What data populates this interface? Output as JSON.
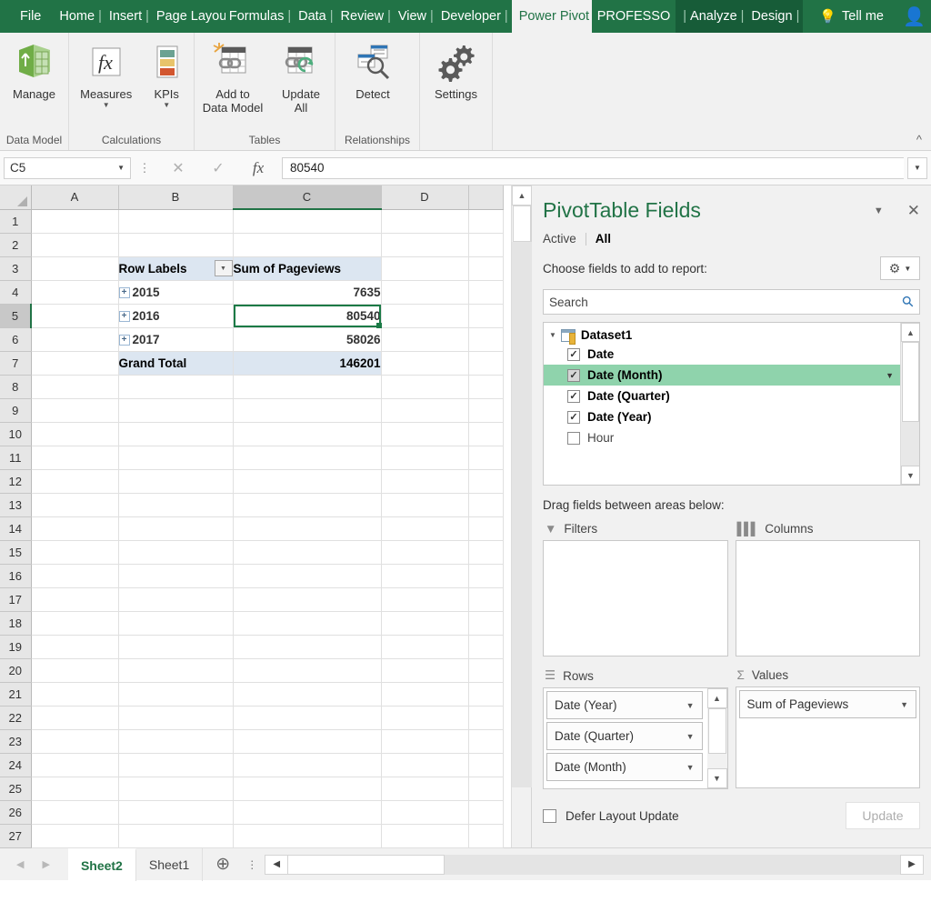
{
  "ribbon": {
    "tabs": [
      {
        "label": "File",
        "active": false
      },
      {
        "label": "Home",
        "active": false
      },
      {
        "label": "Insert",
        "active": false
      },
      {
        "label": "Page Layout",
        "active": false
      },
      {
        "label": "Formulas",
        "active": false
      },
      {
        "label": "Data",
        "active": false
      },
      {
        "label": "Review",
        "active": false
      },
      {
        "label": "View",
        "active": false
      },
      {
        "label": "Developer",
        "active": false
      },
      {
        "label": "Power Pivot",
        "active": true
      }
    ],
    "contextual": {
      "group_label": "PROFESSO",
      "tabs": [
        "Analyze",
        "Design"
      ]
    },
    "tell_me": "Tell me",
    "share_icon": "person-add-icon",
    "collapse_icon": "chevron-up-icon",
    "groups": [
      {
        "title": "Data Model",
        "buttons": [
          {
            "label": "Manage",
            "icon": "power-pivot-manage-icon",
            "caret": false
          }
        ]
      },
      {
        "title": "Calculations",
        "buttons": [
          {
            "label": "Measures",
            "icon": "fx-measures-icon",
            "caret": true
          },
          {
            "label": "KPIs",
            "icon": "kpi-icon",
            "caret": true
          }
        ]
      },
      {
        "title": "Tables",
        "buttons": [
          {
            "label": "Add to\nData Model",
            "icon": "add-to-data-model-icon",
            "caret": false
          },
          {
            "label": "Update\nAll",
            "icon": "update-all-icon",
            "caret": false
          }
        ]
      },
      {
        "title": "Relationships",
        "buttons": [
          {
            "label": "Detect",
            "icon": "detect-relationships-icon",
            "caret": false
          }
        ]
      },
      {
        "title": "",
        "buttons": [
          {
            "label": "Settings",
            "icon": "settings-gears-icon",
            "caret": false
          }
        ]
      }
    ]
  },
  "formula_bar": {
    "name_box": "C5",
    "cancel_icon": "x-icon",
    "confirm_icon": "check-icon",
    "fx_icon": "fx-icon",
    "value": "80540"
  },
  "grid": {
    "columns": [
      "A",
      "B",
      "C",
      "D"
    ],
    "selected_column": "C",
    "selected_row": 5,
    "selected_cell": "C5",
    "rows": [
      1,
      2,
      3,
      4,
      5,
      6,
      7,
      8,
      9,
      10,
      11,
      12,
      13,
      14,
      15,
      16,
      17,
      18,
      19,
      20,
      21,
      22,
      23,
      24,
      25,
      26,
      27
    ],
    "pivot": {
      "header_row": 3,
      "row_labels_header": "Row Labels",
      "value_header": "Sum of Pageviews",
      "filter_icon": "filter-dropdown-icon",
      "expand_icon": "expand-plus-icon",
      "data": [
        {
          "row": 4,
          "label": "2015",
          "value": "7635"
        },
        {
          "row": 5,
          "label": "2016",
          "value": "80540"
        },
        {
          "row": 6,
          "label": "2017",
          "value": "58026"
        }
      ],
      "total_row": {
        "row": 7,
        "label": "Grand Total",
        "value": "146201"
      }
    }
  },
  "pane": {
    "title": "PivotTable Fields",
    "menu_icon": "chevron-down-icon",
    "close_icon": "close-icon",
    "tabs": [
      {
        "label": "Active",
        "active": false
      },
      {
        "label": "All",
        "active": true
      }
    ],
    "choose_label": "Choose fields to add to report:",
    "gear_icon": "gear-icon",
    "gear_caret_icon": "chevron-down-icon",
    "search_placeholder": "Search",
    "search_icon": "search-icon",
    "table_name": "Dataset1",
    "table_icon": "table-icon",
    "fields": [
      {
        "label": "Date",
        "checked": true,
        "highlighted": false,
        "greyed": false
      },
      {
        "label": "Date (Month)",
        "checked": true,
        "highlighted": true,
        "greyed": true
      },
      {
        "label": "Date (Quarter)",
        "checked": true,
        "highlighted": false,
        "greyed": false
      },
      {
        "label": "Date (Year)",
        "checked": true,
        "highlighted": false,
        "greyed": false
      },
      {
        "label": "Hour",
        "checked": false,
        "highlighted": false,
        "greyed": false
      }
    ],
    "drag_label": "Drag fields between areas below:",
    "areas": {
      "filters": {
        "label": "Filters",
        "icon": "funnel-icon",
        "items": []
      },
      "columns": {
        "label": "Columns",
        "icon": "columns-icon",
        "items": []
      },
      "rows": {
        "label": "Rows",
        "icon": "rows-icon",
        "items": [
          {
            "label": "Date (Year)"
          },
          {
            "label": "Date (Quarter)"
          },
          {
            "label": "Date (Month)"
          }
        ]
      },
      "values": {
        "label": "Values",
        "icon": "sigma-icon",
        "items": [
          {
            "label": "Sum of Pageviews"
          }
        ]
      }
    },
    "defer_label": "Defer Layout Update",
    "update_button": "Update"
  },
  "sheet_bar": {
    "prev_icon": "triangle-left-icon",
    "next_icon": "triangle-right-icon",
    "tabs": [
      {
        "label": "Sheet2",
        "active": true
      },
      {
        "label": "Sheet1",
        "active": false
      }
    ],
    "add_sheet_icon": "plus-circle-icon",
    "kebab_icon": "more-options-icon",
    "scroll_left_icon": "triangle-left-icon",
    "scroll_right_icon": "triangle-right-icon"
  },
  "colors": {
    "excel_green": "#217346",
    "contextual_dark": "#175c38",
    "pivot_header_fill": "#dce6f1",
    "selection_green": "#1b7a46",
    "field_highlight": "#8fd3ac"
  }
}
